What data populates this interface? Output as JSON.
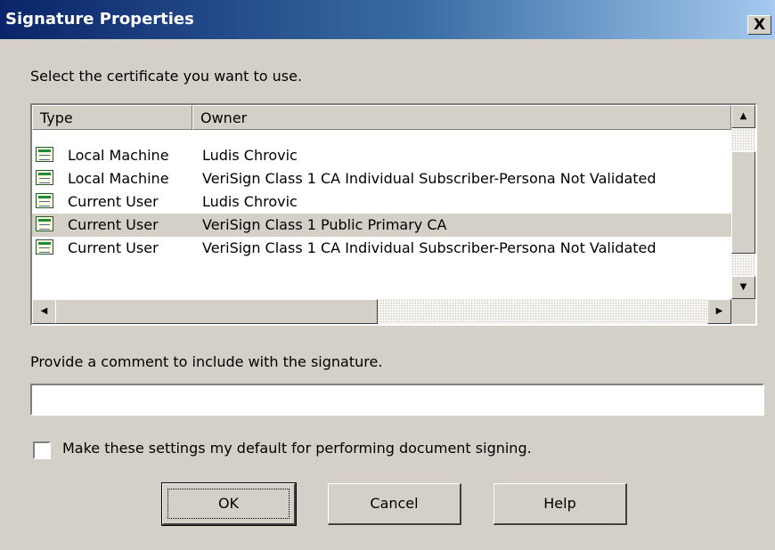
{
  "window": {
    "title": "Signature Properties",
    "close_glyph": "X"
  },
  "certificate_prompt": "Select the certificate you want to use.",
  "certificate_list": {
    "columns": {
      "type": "Type",
      "owner": "Owner"
    },
    "rows": [
      {
        "type": "Local Machine",
        "owner": "Ludis Chrovic",
        "selected": false,
        "icon": "certificate-icon"
      },
      {
        "type": "Local Machine",
        "owner": "VeriSign Class 1 CA Individual Subscriber-Persona Not Validated",
        "selected": false,
        "icon": "certificate-icon"
      },
      {
        "type": "Current User",
        "owner": "Ludis Chrovic",
        "selected": false,
        "icon": "certificate-icon"
      },
      {
        "type": "Current User",
        "owner": "VeriSign Class 1 Public Primary CA",
        "selected": true,
        "icon": "certificate-icon"
      },
      {
        "type": "Current User",
        "owner": "VeriSign Class 1 CA Individual Subscriber-Persona Not Validated",
        "selected": false,
        "icon": "certificate-icon"
      }
    ]
  },
  "comment": {
    "label": "Provide a comment to include with the signature.",
    "value": ""
  },
  "default_checkbox": {
    "label": "Make these settings my default for performing document signing.",
    "checked": false
  },
  "buttons": {
    "ok": "OK",
    "cancel": "Cancel",
    "help": "Help"
  },
  "colors": {
    "title_gradient_start": "#0a246a",
    "title_gradient_end": "#a6caf0",
    "dialog_face": "#d4d0c8"
  }
}
